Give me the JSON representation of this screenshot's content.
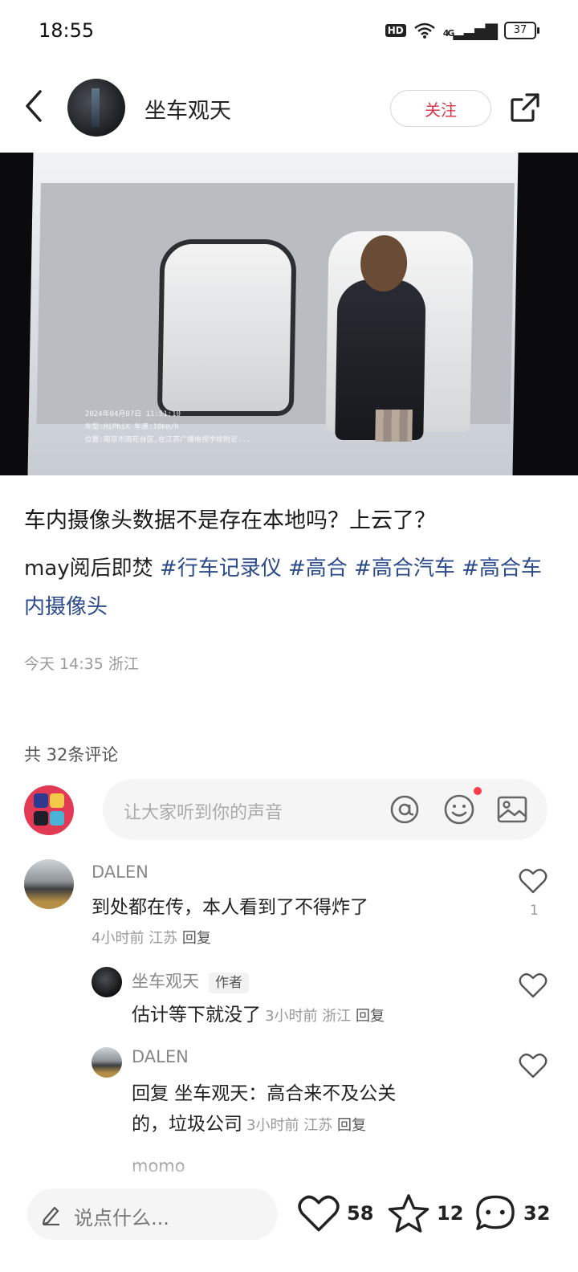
{
  "status": {
    "time": "18:55",
    "network": "4G",
    "battery": "37"
  },
  "header": {
    "author": "坐车观天",
    "follow_label": "关注"
  },
  "photo": {
    "overlay_date": "2024年04月07日  11:51:10",
    "overlay_model": "车型:HiPhiX  车速:10km/h",
    "overlay_location": "位置:南京市雨花台区,在江苏广播电视学校附近..."
  },
  "post": {
    "title": "车内摄像头数据不是存在本地吗？上云了？",
    "body_prefix": "may阅后即焚",
    "tags": [
      "#行车记录仪",
      "#高合",
      "#高合汽车",
      "#高合车内摄像头"
    ],
    "time": "今天 14:35",
    "location": "浙江"
  },
  "comments": {
    "count_label": "共 32条评论",
    "input_placeholder": "让大家听到你的声音",
    "items": [
      {
        "user": "DALEN",
        "text": "到处都在传，本人看到了不得炸了",
        "time": "4小时前",
        "region": "江苏",
        "reply": "回复",
        "likes": "1"
      },
      {
        "user": "坐车观天",
        "badge": "作者",
        "text": "估计等下就没了",
        "time": "3小时前",
        "region": "浙江",
        "reply": "回复"
      },
      {
        "user": "DALEN",
        "text_line1": "回复 坐车观天：高合来不及公关",
        "text_line2": "的，垃圾公司",
        "time": "3小时前",
        "region": "江苏",
        "reply": "回复"
      },
      {
        "user": "momo"
      }
    ]
  },
  "bottom": {
    "say_placeholder": "说点什么...",
    "likes": "58",
    "stars": "12",
    "comments": "32"
  },
  "colors": {
    "accent": "#d83a4e",
    "tag": "#2a4a8a"
  }
}
